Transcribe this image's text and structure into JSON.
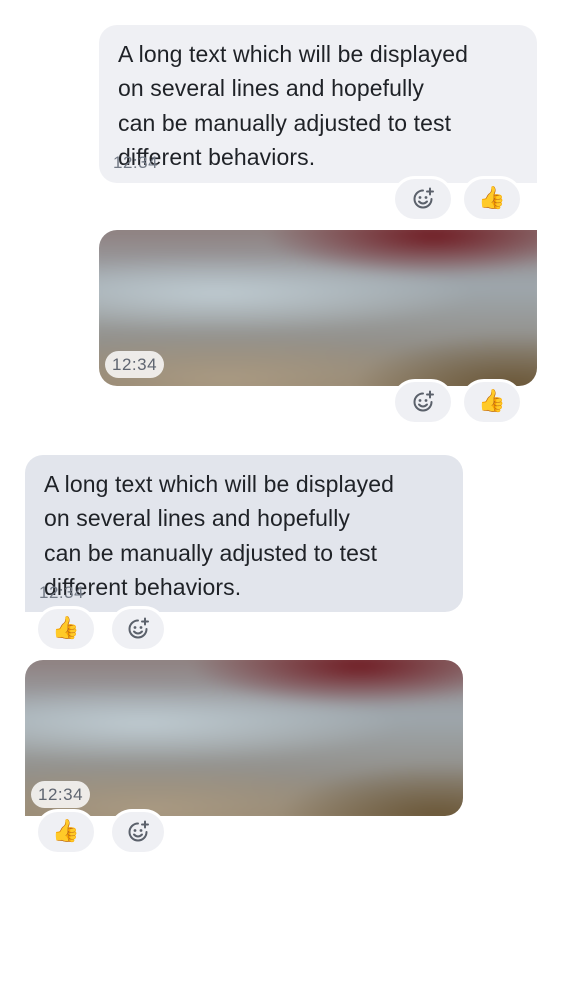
{
  "messages": [
    {
      "direction": "outgoing",
      "kind": "text",
      "lines": [
        "A long text which will be displayed",
        "on several lines and hopefully",
        "can be manually adjusted to test",
        "different behaviors."
      ],
      "timestamp": "12:34",
      "reactions": {
        "add_icon": "add-reaction-icon",
        "emoji": "👍"
      }
    },
    {
      "direction": "outgoing",
      "kind": "image",
      "timestamp": "12:34",
      "reactions": {
        "add_icon": "add-reaction-icon",
        "emoji": "👍"
      }
    },
    {
      "direction": "incoming",
      "kind": "text",
      "lines": [
        "A long text which will be displayed",
        "on several lines and hopefully",
        "can be manually adjusted to test",
        "different behaviors."
      ],
      "timestamp": "12:34",
      "reactions": {
        "emoji": "👍",
        "add_icon": "add-reaction-icon"
      }
    },
    {
      "direction": "incoming",
      "kind": "image",
      "timestamp": "12:34",
      "reactions": {
        "emoji": "👍",
        "add_icon": "add-reaction-icon"
      }
    }
  ],
  "colors": {
    "outgoing_bubble": "#eff0f4",
    "incoming_bubble": "#e2e5ec",
    "text": "#1f2227",
    "timestamp": "#737a86",
    "reaction_emoji": "#f3c12e"
  }
}
